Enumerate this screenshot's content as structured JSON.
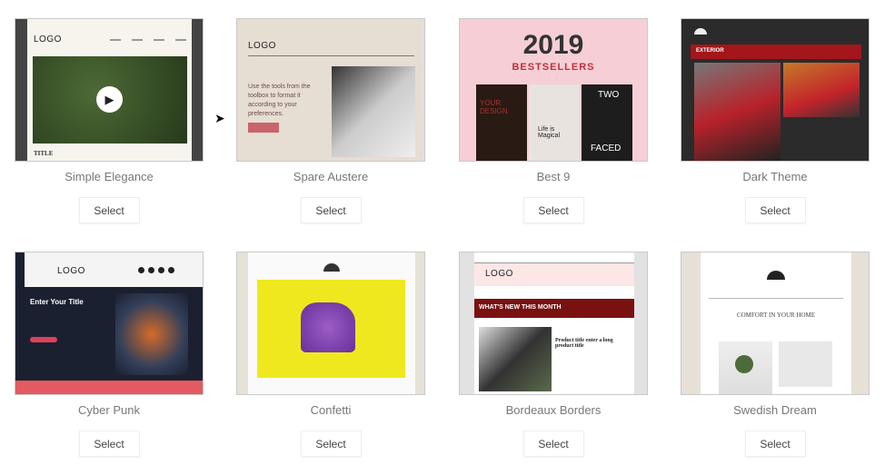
{
  "templates": [
    {
      "name": "Simple Elegance",
      "select": "Select",
      "logo": "LOGO",
      "footer": "TITLE"
    },
    {
      "name": "Spare Austere",
      "select": "Select",
      "logo": "LOGO",
      "body": "Use the tools from the toolbox to format it according to your preferences."
    },
    {
      "name": "Best 9",
      "select": "Select",
      "year": "2019",
      "subtitle": "BESTSELLERS",
      "tag1": "YOUR DESIGN",
      "tag2": "Life is Magical",
      "tag3": "TWO",
      "tag4": "FACED"
    },
    {
      "name": "Dark Theme",
      "select": "Select",
      "banner": "EXTERIOR"
    },
    {
      "name": "Cyber Punk",
      "select": "Select",
      "logo": "LOGO",
      "title": "Enter Your Title"
    },
    {
      "name": "Confetti",
      "select": "Select"
    },
    {
      "name": "Bordeaux Borders",
      "select": "Select",
      "logo": "LOGO",
      "banner": "WHAT'S NEW THIS MONTH",
      "product": "Product title enter a long product title"
    },
    {
      "name": "Swedish Dream",
      "select": "Select",
      "title": "COMFORT IN YOUR HOME"
    }
  ],
  "colors": {
    "bordeaux": "#7a1111",
    "pink": "#f6cfd6",
    "yellow": "#f0e81e",
    "dark": "#2a2a2a"
  }
}
